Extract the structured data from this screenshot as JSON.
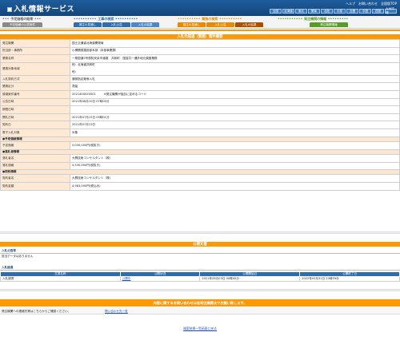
{
  "header": {
    "title": "入札情報サービス",
    "links": [
      "ヘルプ",
      "お問い合わせ",
      "全国版TOP"
    ],
    "regions": [
      "全国",
      "北海道",
      "東北",
      "関東",
      "北陸",
      "中部",
      "近畿",
      "中国",
      "四国",
      "九州沖縄"
    ]
  },
  "nav": {
    "groups": [
      {
        "title": "予定価格の結果",
        "tabs": [
          "予定価格の公表案件"
        ]
      },
      {
        "title": "工事の検索",
        "tabs": [
          "発注の見通し",
          "入札公告",
          "入札の結果"
        ]
      },
      {
        "title": "業務の検索",
        "tabs": [
          "発注の見通し",
          "入札公告",
          "入札の結果"
        ]
      },
      {
        "title": "発注機関の情報",
        "tabs": [
          "発注機関情報"
        ]
      }
    ]
  },
  "detail": {
    "title": "入札の経過（業務）案件概要",
    "rows": [
      {
        "k": "発注機関",
        "v": "国土交通省北海道開発局"
      },
      {
        "k": "担当部・事務所",
        "v": "小樽開発建設部本部（本部事業課）"
      },
      {
        "k": "業務名称",
        "v": "一般国道5号倶知安余市道路　共和町　国富共一通外地元調査業務"
      },
      {
        "k": "業務対象地域",
        "v": "他：北海道共和町",
        "v2": "他："
      },
      {
        "k": "入札契約方式",
        "v": "通常指名競争入札"
      },
      {
        "k": "業務区分",
        "v": "測量"
      },
      {
        "k": "調達案件番号",
        "v": "2021400020001",
        "note": "※発注機関が独自に定めるコード"
      },
      {
        "k": "公告日時",
        "v": "2021年06月10日 07時00分"
      },
      {
        "k": "期限日時",
        "v": ""
      },
      {
        "k": "開札日時",
        "v": "2021年07月15日 09時01分"
      },
      {
        "k": "契約日",
        "v": "2021年07月15日"
      },
      {
        "k": "電子入札対象",
        "v": "対象"
      }
    ],
    "planned_header": "●予定価格情報",
    "planned": [
      {
        "k": "予定価格",
        "v": "5,030,000円(税抜き)"
      }
    ],
    "winner_header": "●落札者情報",
    "winner": [
      {
        "k": "落札者名",
        "v": "大興技術コンサルタント（株）"
      },
      {
        "k": "落札価格",
        "v": "4,530,000円(税抜き)"
      }
    ],
    "contract_header": "●契約情報",
    "contract": [
      {
        "k": "契約者名",
        "v": "大興技術コンサルタント（株）"
      },
      {
        "k": "契約金額",
        "v": "4,983,000円(税込み)"
      }
    ]
  },
  "public_docs": {
    "title": "公開文書",
    "notice_label": "入札公告等",
    "notice_empty": "該当データはありません",
    "process_label": "入札経過",
    "columns": [
      "文書名称",
      "公開状況",
      "公開開始日",
      "公開終了日"
    ],
    "rows": [
      {
        "name": "入札調書",
        "status": "公開中",
        "start": "2021年08月03日 00時00分",
        "end": "2022年05月31日 23時59分"
      }
    ]
  },
  "contact": {
    "bar": "内容に関するお問い合わせは各発注機関までお願い致します。",
    "left": "発注機関への連絡先等はこちらからご確認ください。",
    "link": "問い合わせ先一覧"
  },
  "back_link": "検索結果一覧画面に戻る"
}
